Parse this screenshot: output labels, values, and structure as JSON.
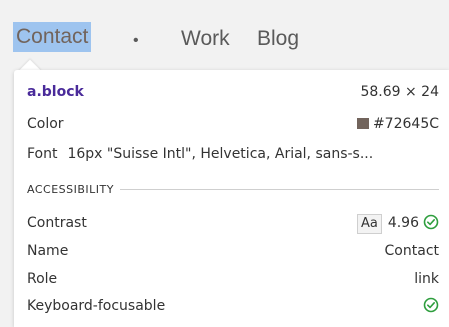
{
  "nav": {
    "items": [
      {
        "label": "Contact"
      },
      {
        "label": "•"
      },
      {
        "label": "Work"
      },
      {
        "label": "Blog"
      }
    ]
  },
  "inspector": {
    "selector": "a.block",
    "dimensions": "58.69 × 24",
    "color_label": "Color",
    "color_value": "#72645C",
    "font_label": "Font",
    "font_value": "16px \"Suisse Intl\", Helvetica, Arial, sans-s...",
    "section_title": "ACCESSIBILITY",
    "contrast_label": "Contrast",
    "contrast_badge": "Aa",
    "contrast_value": "4.96",
    "name_label": "Name",
    "name_value": "Contact",
    "role_label": "Role",
    "role_value": "link",
    "keyboard_label": "Keyboard-focusable",
    "icons": {
      "swatch": "color-swatch-icon",
      "contrast_ok": "check-circle-icon",
      "keyboard_ok": "check-circle-icon"
    }
  },
  "colors": {
    "swatch": "#72645C",
    "selection": "#9ec4ef",
    "ok_green": "#2e9e3e",
    "selector_purple": "#4a2b9a"
  }
}
